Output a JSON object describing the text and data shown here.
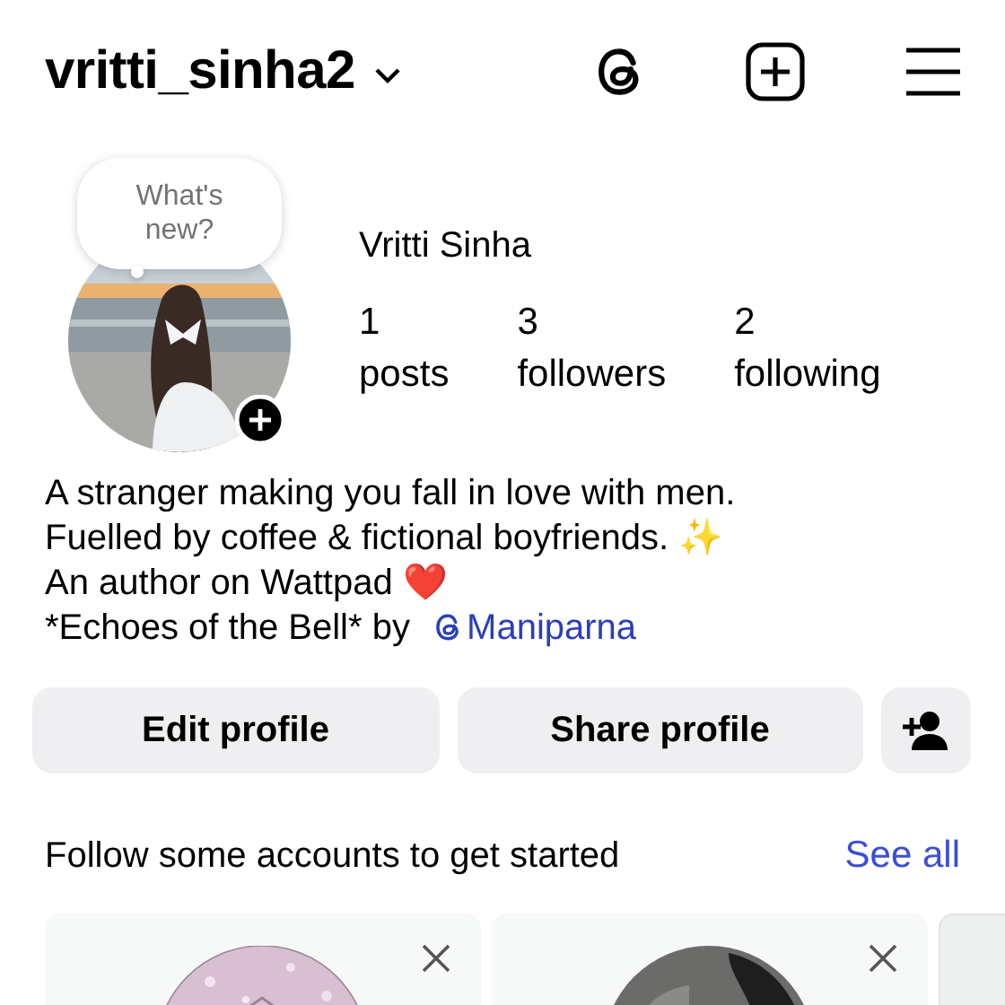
{
  "header": {
    "username": "vritti_sinha2"
  },
  "profile": {
    "story_bubble": "What's new?",
    "name": "Vritti Sinha",
    "stats": [
      {
        "value": "1",
        "label": "posts"
      },
      {
        "value": "3",
        "label": "followers"
      },
      {
        "value": "2",
        "label": "following"
      }
    ]
  },
  "bio": [
    {
      "text": "A stranger making you fall in love with men."
    },
    {
      "text": "Fuelled by coffee & fictional boyfriends. ✨"
    },
    {
      "text": "An author on Wattpad ❤️"
    },
    {
      "text": "*Echoes of the Bell* by",
      "link": "Maniparna"
    }
  ],
  "actions": [
    "Edit profile",
    "Share profile"
  ],
  "suggestions": {
    "title": "Follow some accounts to get started",
    "see_all": "See all",
    "cards": [
      {
        "kind": "pink"
      },
      {
        "kind": "dark"
      },
      {
        "kind": "blank"
      }
    ]
  }
}
